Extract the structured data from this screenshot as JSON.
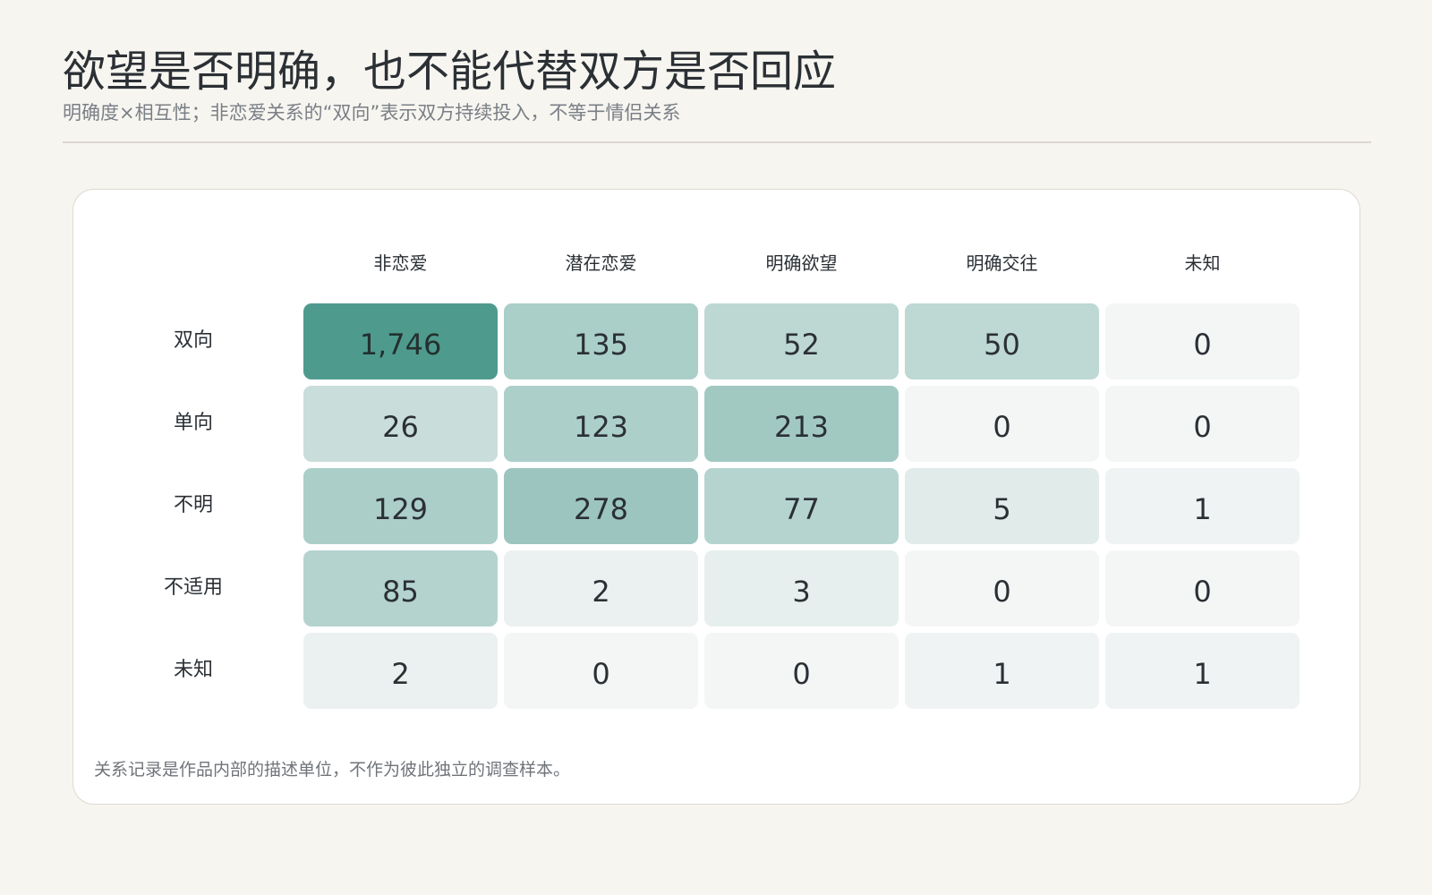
{
  "header": {
    "title": "欲望是否明确，也不能代替双方是否回应",
    "subtitle": "明确度×相互性；非恋爱关系的“双向”表示双方持续投入，不等于情侣关系"
  },
  "footnote": "关系记录是作品内部的描述单位，不作为彼此独立的调查样本。",
  "colors": {
    "background": "#f7f5f0",
    "card": "#ffffff",
    "heat_low": "#f4f6f6",
    "heat_high": "#4e9b8e"
  },
  "chart_data": {
    "type": "heatmap",
    "title": "欲望是否明确，也不能代替双方是否回应",
    "subtitle": "明确度×相互性；非恋爱关系的“双向”表示双方持续投入，不等于情侣关系",
    "columns": [
      "非恋爱",
      "潜在恋爱",
      "明确欲望",
      "明确交往",
      "未知"
    ],
    "rows": [
      "双向",
      "单向",
      "不明",
      "不适用",
      "未知"
    ],
    "values": [
      [
        1746,
        135,
        52,
        50,
        0
      ],
      [
        26,
        123,
        213,
        0,
        0
      ],
      [
        129,
        278,
        77,
        5,
        1
      ],
      [
        85,
        2,
        3,
        0,
        0
      ],
      [
        2,
        0,
        0,
        1,
        1
      ]
    ],
    "display_values": [
      [
        "1,746",
        "135",
        "52",
        "50",
        "0"
      ],
      [
        "26",
        "123",
        "213",
        "0",
        "0"
      ],
      [
        "129",
        "278",
        "77",
        "5",
        "1"
      ],
      [
        "85",
        "2",
        "3",
        "0",
        "0"
      ],
      [
        "2",
        "0",
        "0",
        "1",
        "1"
      ]
    ],
    "color_scale": "teal, log-scaled intensity"
  }
}
